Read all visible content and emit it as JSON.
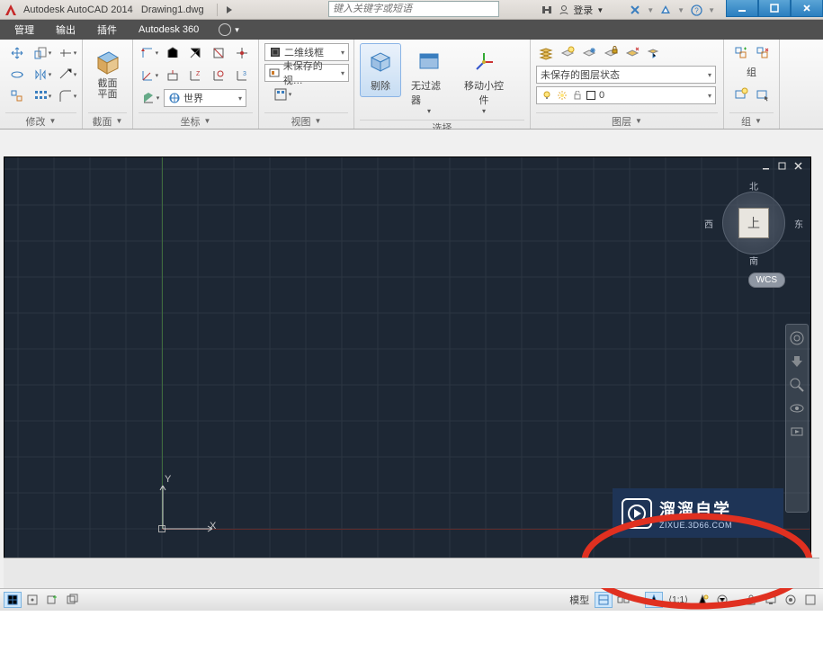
{
  "app": {
    "name": "Autodesk AutoCAD 2014",
    "doc": "Drawing1.dwg"
  },
  "search": {
    "placeholder": "键入关键字或短语"
  },
  "login": {
    "label": "登录"
  },
  "tabs": {
    "manage": "管理",
    "output": "输出",
    "plugin": "插件",
    "a360": "Autodesk 360"
  },
  "ribbon": {
    "panel_modify": "修改",
    "panel_section": "截面",
    "section_btn": "截面\n平面",
    "panel_coord": "坐标",
    "panel_view": "视图",
    "visual_style": "二维线框",
    "save_view": "未保存的视…",
    "world": "世界",
    "panel_select": "选择",
    "eliminate": "剔除",
    "nofilter": "无过滤器",
    "move_widget": "移动小控件",
    "panel_layer": "图层",
    "layer_state": "未保存的图层状态",
    "layer_zero": "0",
    "panel_group": "组"
  },
  "viewcube": {
    "n": "北",
    "s": "南",
    "e": "东",
    "w": "西",
    "top": "上",
    "wcs": "WCS"
  },
  "canvas": {
    "y": "Y",
    "x": "X"
  },
  "watermark": {
    "title": "溜溜自学",
    "sub": "ZIXUE.3D66.COM"
  },
  "status": {
    "model": "模型"
  }
}
